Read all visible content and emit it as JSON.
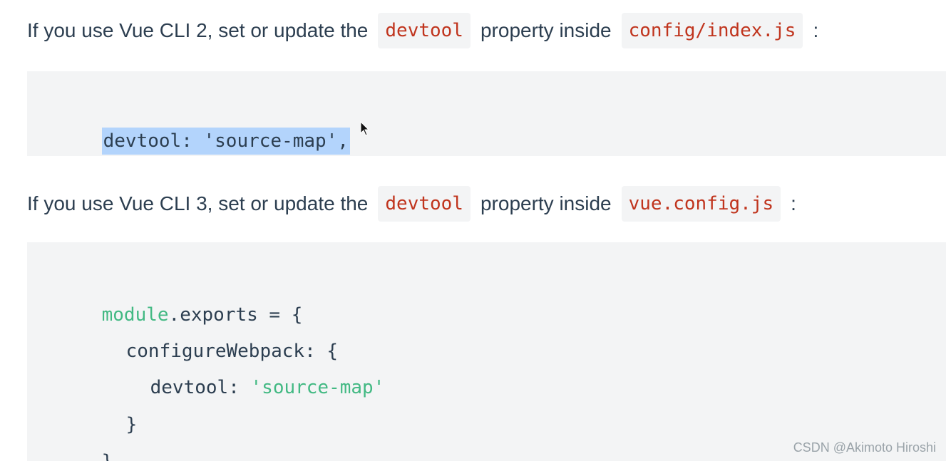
{
  "para1": {
    "before": "If you use Vue CLI 2, set or update the",
    "code1": "devtool",
    "middle": "property inside",
    "code2": "config/index.js",
    "after": ":"
  },
  "block1": {
    "line1": "devtool: 'source-map',"
  },
  "para2": {
    "before": "If you use Vue CLI 3, set or update the",
    "code1": "devtool",
    "middle": "property inside",
    "code2": "vue.config.js",
    "after": ":"
  },
  "block2": {
    "l1_a": "module",
    "l1_b": ".exports = {",
    "l2": "configureWebpack: {",
    "l3_a": "devtool: ",
    "l3_b": "'source-map'",
    "l4": "}",
    "l5": "}"
  },
  "watermark": "CSDN @Akimoto Hiroshi",
  "colors": {
    "text": "#2c3e50",
    "inline_code": "#c0341d",
    "code_bg": "#f3f4f5",
    "string_green": "#42b983",
    "selection": "#b3d4fc"
  },
  "icons": {
    "cursor": "mouse-pointer-icon"
  }
}
